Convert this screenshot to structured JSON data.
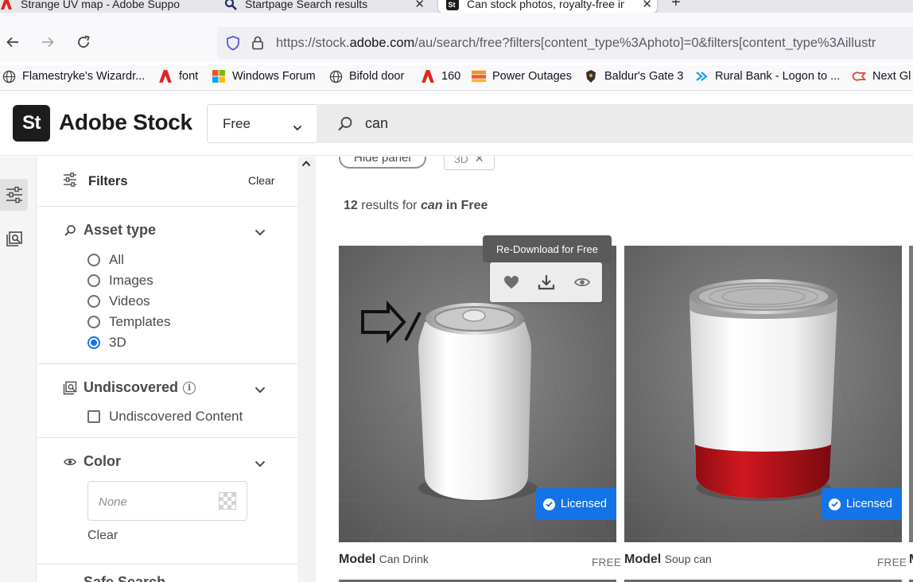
{
  "browser": {
    "tabs": [
      {
        "title": "Strange UV map - Adobe Suppo"
      },
      {
        "title": "Startpage Search results"
      },
      {
        "title": "Can stock photos, royalty-free im"
      }
    ],
    "url_prefix": "https://stock.",
    "url_domain": "adobe.com",
    "url_suffix": "/au/search/free?filters[content_type%3Aphoto]=0&filters[content_type%3Aillustr",
    "bookmarks": [
      {
        "label": "Flamestryke's Wizardr...",
        "icon": "globe-icon"
      },
      {
        "label": "font",
        "icon": "adobe-icon"
      },
      {
        "label": "Windows Forum",
        "icon": "windows-forum-icon"
      },
      {
        "label": "Bifold door",
        "icon": "globe-icon"
      },
      {
        "label": "160",
        "icon": "adobe-icon"
      },
      {
        "label": "Power Outages",
        "icon": "power-outages-icon"
      },
      {
        "label": "Baldur's Gate 3",
        "icon": "baldurs-gate-icon"
      },
      {
        "label": "Rural Bank - Logon to ...",
        "icon": "rural-bank-icon"
      },
      {
        "label": "Next Gl",
        "icon": "next-icon"
      }
    ]
  },
  "header": {
    "logo_mark": "St",
    "logo_text": "Adobe Stock",
    "scope_value": "Free",
    "search_value": "can"
  },
  "filters": {
    "title": "Filters",
    "clear": "Clear",
    "asset_type": {
      "title": "Asset type",
      "options": [
        "All",
        "Images",
        "Videos",
        "Templates",
        "3D"
      ],
      "selected": "3D"
    },
    "undiscovered": {
      "title": "Undiscovered",
      "option": "Undiscovered Content",
      "checked": false
    },
    "color": {
      "title": "Color",
      "placeholder": "None",
      "clear": "Clear"
    },
    "next_section": "Safe Search"
  },
  "results": {
    "chip_hide": "Hide panel",
    "chip_filter": "3D",
    "count_number": "12",
    "count_mid": "results for",
    "count_query": "can",
    "count_in": "in Free",
    "tooltip": "Re-Download for Free",
    "items": [
      {
        "type": "Model",
        "name": "Can Drink",
        "badge": "Licensed",
        "price": "FREE"
      },
      {
        "type": "Model",
        "name": "Soup can",
        "badge": "Licensed",
        "price": "FREE"
      },
      {
        "type": "M"
      }
    ]
  },
  "colors": {
    "accent": "#1473e6",
    "soup_can_band": "#c0121b",
    "card_bg": "#777777"
  }
}
